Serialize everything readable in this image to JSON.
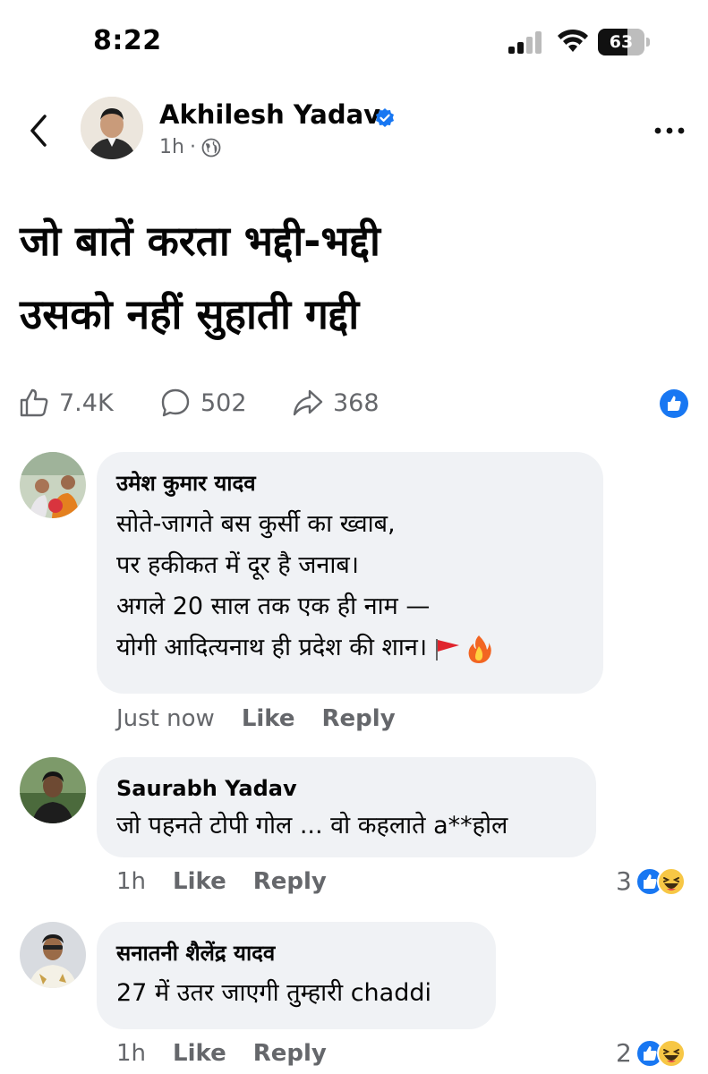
{
  "status_bar": {
    "time": "8:22",
    "battery_level": "63",
    "battery_fraction": 0.63
  },
  "post": {
    "author": "Akhilesh Yadav",
    "time_ago": "1h",
    "separator": "·",
    "text_lines": [
      "जो बातें करता भद्दी-भद्दी",
      "उसको नहीं सुहाती गद्दी"
    ],
    "likes": "7.4K",
    "comments": "502",
    "shares": "368"
  },
  "comments": [
    {
      "name": "उमेश कुमार यादव",
      "lines": [
        "सोते-जागते बस कुर्सी का ख्वाब,",
        "पर हकीकत में दूर है जनाब।",
        "अगले 20 साल तक एक ही नाम —",
        "योगी आदित्यनाथ ही प्रदेश की शान।"
      ],
      "time": "Just now",
      "like_label": "Like",
      "reply_label": "Reply"
    },
    {
      "name": "Saurabh Yadav",
      "lines": [
        "जो पहनते टोपी गोल ... वो कहलाते a**होल"
      ],
      "time": "1h",
      "like_label": "Like",
      "reply_label": "Reply",
      "reaction_count": "3"
    },
    {
      "name": "सनातनी शैलेंद्र यादव",
      "lines": [
        "27 में उतर जाएगी तुम्हारी chaddi"
      ],
      "time": "1h",
      "like_label": "Like",
      "reply_label": "Reply",
      "reaction_count": "2"
    }
  ],
  "icons": {
    "back": "chevron-left-icon",
    "more": "more-horizontal-icon",
    "verified": "verified-badge-icon",
    "audience": "globe-icon",
    "like": "thumbs-up-icon",
    "comment": "comment-bubble-icon",
    "share": "share-arrow-icon"
  },
  "colors": {
    "facebook_blue": "#1877F2",
    "text_primary": "#050505",
    "text_secondary": "#65676B",
    "bubble_background": "#F0F2F5"
  }
}
